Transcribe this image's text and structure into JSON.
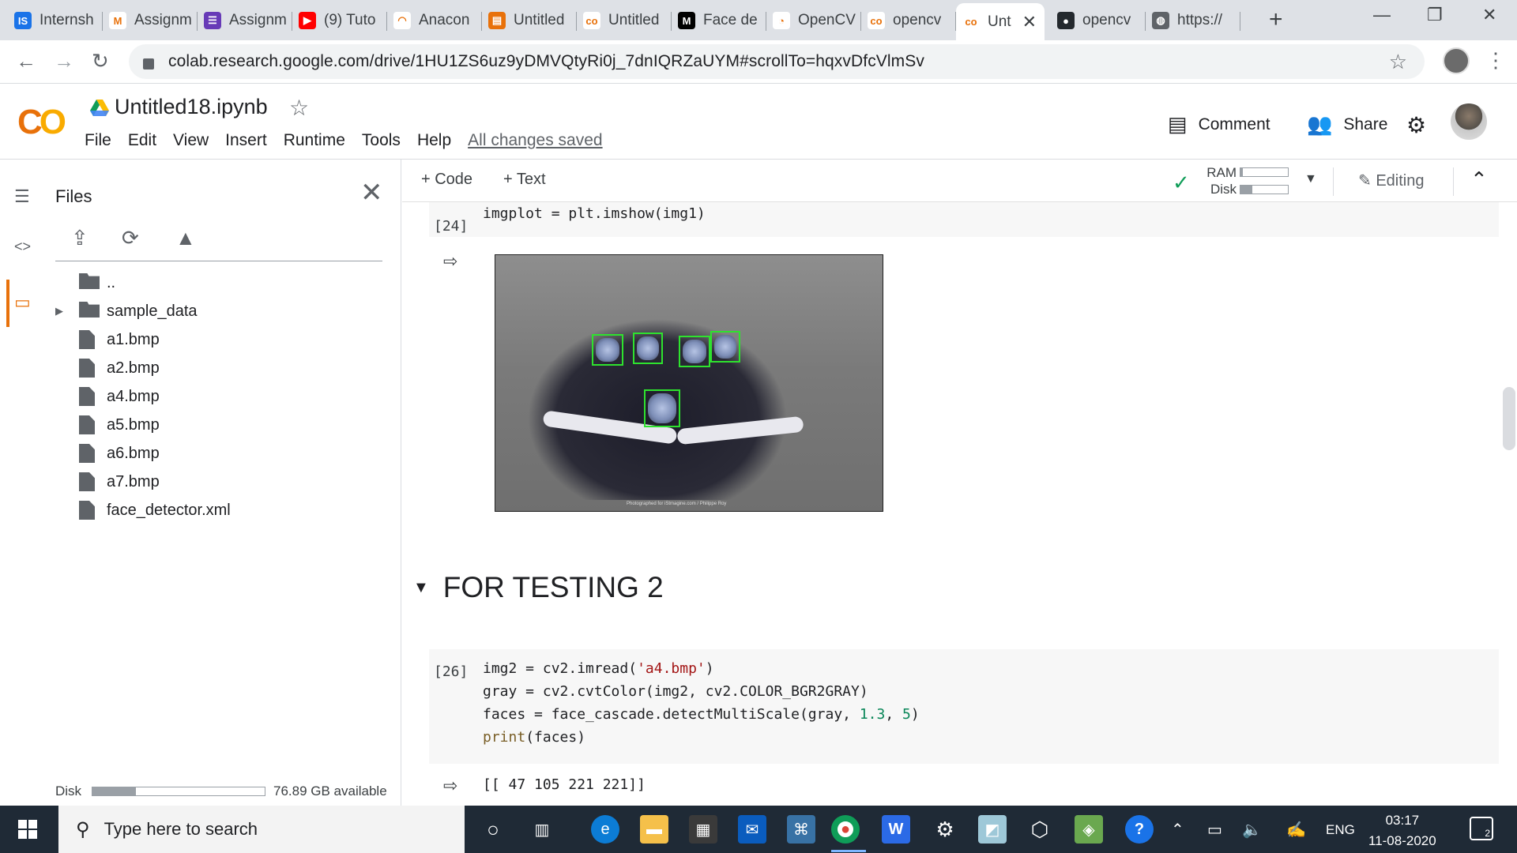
{
  "browser": {
    "tabs": [
      {
        "title": "Internsh",
        "favicon": "internshala-icon",
        "color": "#1a73e8",
        "glyph": "IS"
      },
      {
        "title": "Assignm",
        "favicon": "gmail-icon",
        "color": "#ffffff",
        "glyph": "M"
      },
      {
        "title": "Assignm",
        "favicon": "form-icon",
        "color": "#673ab7",
        "glyph": "☰"
      },
      {
        "title": "(9) Tuto",
        "favicon": "youtube-icon",
        "color": "#ff0000",
        "glyph": "▶"
      },
      {
        "title": "Anacon",
        "favicon": "anaconda-icon",
        "color": "#ffffff",
        "glyph": "◠"
      },
      {
        "title": "Untitled",
        "favicon": "jupyter-icon",
        "color": "#e8710a",
        "glyph": "▤"
      },
      {
        "title": "Untitled",
        "favicon": "colab-icon",
        "color": "#ffffff",
        "glyph": "co"
      },
      {
        "title": "Face de",
        "favicon": "medium-icon",
        "color": "#000000",
        "glyph": "M"
      },
      {
        "title": "OpenCV",
        "favicon": "opencv-icon",
        "color": "#ffffff",
        "glyph": "◔"
      },
      {
        "title": "opencv",
        "favicon": "colab-icon",
        "color": "#ffffff",
        "glyph": "co"
      },
      {
        "title": "Unt",
        "favicon": "colab-icon",
        "color": "#ffffff",
        "glyph": "co",
        "active": true
      },
      {
        "title": "opencv",
        "favicon": "github-icon",
        "color": "#24292e",
        "glyph": "●"
      },
      {
        "title": "https://",
        "favicon": "globe-icon",
        "color": "#5f6368",
        "glyph": "◍"
      }
    ],
    "url": "colab.research.google.com/drive/1HU1ZS6uz9yDMVQtyRi0j_7dnIQRZaUYM#scrollTo=hqxvDfcVlmSv"
  },
  "colab": {
    "notebook_title": "Untitled18.ipynb",
    "menu": [
      "File",
      "Edit",
      "View",
      "Insert",
      "Runtime",
      "Tools",
      "Help"
    ],
    "save_status": "All changes saved",
    "comment_label": "Comment",
    "share_label": "Share",
    "toolbar": {
      "add_code": "+ Code",
      "add_text": "+ Text",
      "ram_label": "RAM",
      "disk_label": "Disk",
      "ram_fraction": 0.05,
      "disk_fraction": 0.25,
      "editing_label": "Editing"
    }
  },
  "files_panel": {
    "title": "Files",
    "items": [
      {
        "name": "..",
        "kind": "up-folder"
      },
      {
        "name": "sample_data",
        "kind": "folder"
      },
      {
        "name": "a1.bmp",
        "kind": "file"
      },
      {
        "name": "a2.bmp",
        "kind": "file"
      },
      {
        "name": "a4.bmp",
        "kind": "file"
      },
      {
        "name": "a5.bmp",
        "kind": "file"
      },
      {
        "name": "a6.bmp",
        "kind": "file"
      },
      {
        "name": "a7.bmp",
        "kind": "file"
      },
      {
        "name": "face_detector.xml",
        "kind": "file"
      }
    ],
    "disk_label": "Disk",
    "disk_fraction": 0.25,
    "disk_available": "76.89 GB available"
  },
  "cells": {
    "cell1": {
      "exec": "[24]",
      "code": "imgplot = plt.imshow(img1)"
    },
    "section_heading": "FOR TESTING 2",
    "cell2": {
      "exec": "[26]",
      "line1": "img2 = cv2.imread(",
      "line1_str": "'a4.bmp'",
      "line1_end": ")",
      "line2": "gray = cv2.cvtColor(img2, cv2.COLOR_BGR2GRAY)",
      "line3": "faces = face_cascade.detectMultiScale(gray, ",
      "line3_n1": "1.3",
      "line3_sep": ", ",
      "line3_n2": "5",
      "line3_end": ")",
      "line4_fn": "print",
      "line4": "(faces)",
      "output": "[[ 47 105 221 221]]"
    },
    "image_credit": "Photographed for iStmagine.com / Philippe Roy"
  },
  "taskbar": {
    "search_placeholder": "Type here to search",
    "language": "ENG",
    "time": "03:17",
    "date": "11-08-2020",
    "notification_count": "2"
  }
}
